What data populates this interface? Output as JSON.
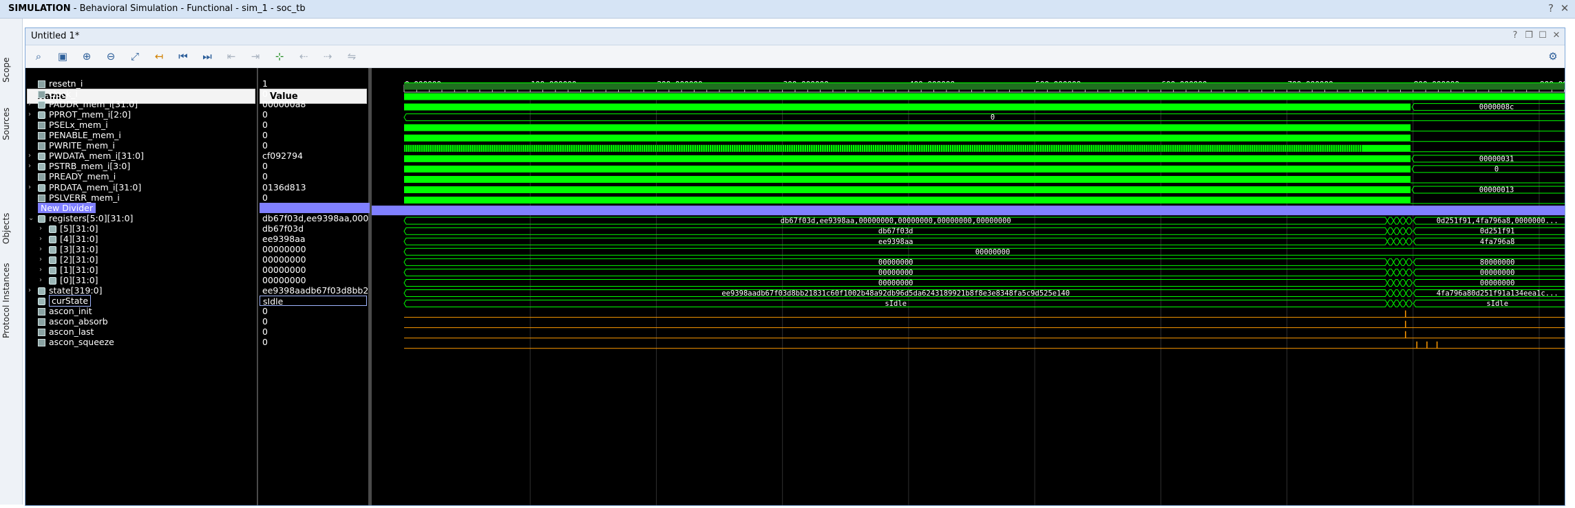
{
  "window": {
    "app": "SIMULATION",
    "subtitle": " - Behavioral Simulation - Functional - sim_1 - soc_tb",
    "help_icon": "question-icon",
    "close_icon": "close-icon"
  },
  "side_tabs": [
    "Scope",
    "Sources",
    "Objects",
    "Protocol Instances"
  ],
  "panel": {
    "title": "Untitled 1*"
  },
  "toolbar": {
    "icons": [
      "search-icon",
      "save-icon",
      "zoom-in-icon",
      "zoom-out-icon",
      "zoom-fit-icon",
      "go-to-cursor-icon",
      "go-to-start-icon",
      "go-to-end-icon",
      "prev-transition-icon",
      "next-transition-icon",
      "add-marker-icon",
      "prev-marker-icon",
      "next-marker-icon",
      "swap-cursors-icon"
    ]
  },
  "columns": {
    "name": "Name",
    "value": "Value"
  },
  "timeline": {
    "ticks": [
      "0.000000 us",
      "100.000000 us",
      "200.000000 us",
      "300.000000 us",
      "400.000000 us",
      "500.000000 us",
      "600.000000 us",
      "700.000000 us",
      "800.000000 us",
      "900.000"
    ]
  },
  "signals": [
    {
      "name": "resetn_i",
      "value": "1",
      "kind": "bit",
      "expand": false,
      "indent": 0
    },
    {
      "name": "clock_i",
      "value": "0",
      "kind": "bit",
      "expand": false,
      "indent": 0
    },
    {
      "name": "PADDR_mem_i[31:0]",
      "value": "000000a8",
      "kind": "bus",
      "expand": true,
      "indent": 0,
      "end_label": "0000008c"
    },
    {
      "name": "PPROT_mem_i[2:0]",
      "value": "0",
      "kind": "bus",
      "expand": true,
      "indent": 0,
      "mid_label": "0"
    },
    {
      "name": "PSELx_mem_i",
      "value": "0",
      "kind": "bit",
      "expand": false,
      "indent": 0
    },
    {
      "name": "PENABLE_mem_i",
      "value": "0",
      "kind": "bit",
      "expand": false,
      "indent": 0
    },
    {
      "name": "PWRITE_mem_i",
      "value": "0",
      "kind": "bit",
      "expand": false,
      "indent": 0
    },
    {
      "name": "PWDATA_mem_i[31:0]",
      "value": "cf092794",
      "kind": "bus",
      "expand": true,
      "indent": 0,
      "end_label": "00000031"
    },
    {
      "name": "PSTRB_mem_i[3:0]",
      "value": "0",
      "kind": "bus",
      "expand": true,
      "indent": 0,
      "end_label": "0"
    },
    {
      "name": "PREADY_mem_i",
      "value": "0",
      "kind": "bit",
      "expand": false,
      "indent": 0
    },
    {
      "name": "PRDATA_mem_i[31:0]",
      "value": "0136d813",
      "kind": "bus",
      "expand": true,
      "indent": 0,
      "end_label": "00000013"
    },
    {
      "name": "PSLVERR_mem_i",
      "value": "0",
      "kind": "bit",
      "expand": false,
      "indent": 0
    },
    {
      "name": "New Divider",
      "value": "",
      "kind": "divider",
      "expand": false,
      "indent": 0
    },
    {
      "name": "registers[5:0][31:0]",
      "value": "db67f03d,ee9398aa,000",
      "kind": "bus",
      "expand": true,
      "open": true,
      "indent": 0,
      "mid_label": "db67f03d,ee9398aa,00000000,00000000,00000000,00000000",
      "end_label": "0d251f91,4fa796a8,0000000..."
    },
    {
      "name": "[5][31:0]",
      "value": "db67f03d",
      "kind": "bus",
      "expand": true,
      "indent": 1,
      "mid_label": "db67f03d",
      "end_label": "0d251f91"
    },
    {
      "name": "[4][31:0]",
      "value": "ee9398aa",
      "kind": "bus",
      "expand": true,
      "indent": 1,
      "mid_label": "ee9398aa",
      "end_label": "4fa796a8"
    },
    {
      "name": "[3][31:0]",
      "value": "00000000",
      "kind": "bus",
      "expand": true,
      "indent": 1,
      "mid_label": "00000000"
    },
    {
      "name": "[2][31:0]",
      "value": "00000000",
      "kind": "bus",
      "expand": true,
      "indent": 1,
      "mid_label": "00000000",
      "end_label": "80000000"
    },
    {
      "name": "[1][31:0]",
      "value": "00000000",
      "kind": "bus",
      "expand": true,
      "indent": 1,
      "mid_label": "00000000",
      "end_label": "00000000"
    },
    {
      "name": "[0][31:0]",
      "value": "00000000",
      "kind": "bus",
      "expand": true,
      "indent": 1,
      "mid_label": "00000000",
      "end_label": "00000000"
    },
    {
      "name": "state[319:0]",
      "value": "ee9398aadb67f03d8bb2",
      "kind": "bus",
      "expand": true,
      "indent": 0,
      "mid_label": "ee9398aadb67f03d8bb21831c60f1002b48a92db96d5da6243189921b8f8e3e8348fa5c9d525e140",
      "end_label": "4fa796a80d251f91a134eea1c..."
    },
    {
      "name": "curState",
      "value": "sIdle",
      "kind": "bus",
      "expand": false,
      "indent": 0,
      "selected": true,
      "mid_label": "sIdle",
      "end_label": "sIdle"
    },
    {
      "name": "ascon_init",
      "value": "0",
      "kind": "bit",
      "expand": false,
      "indent": 0
    },
    {
      "name": "ascon_absorb",
      "value": "0",
      "kind": "bit",
      "expand": false,
      "indent": 0
    },
    {
      "name": "ascon_last",
      "value": "0",
      "kind": "bit",
      "expand": false,
      "indent": 0
    },
    {
      "name": "ascon_squeeze",
      "value": "0",
      "kind": "bit",
      "expand": false,
      "indent": 0
    }
  ],
  "colors": {
    "green": "#00ff00",
    "orange": "#ff9a00",
    "divider": "#8080ff",
    "background": "#000000"
  }
}
